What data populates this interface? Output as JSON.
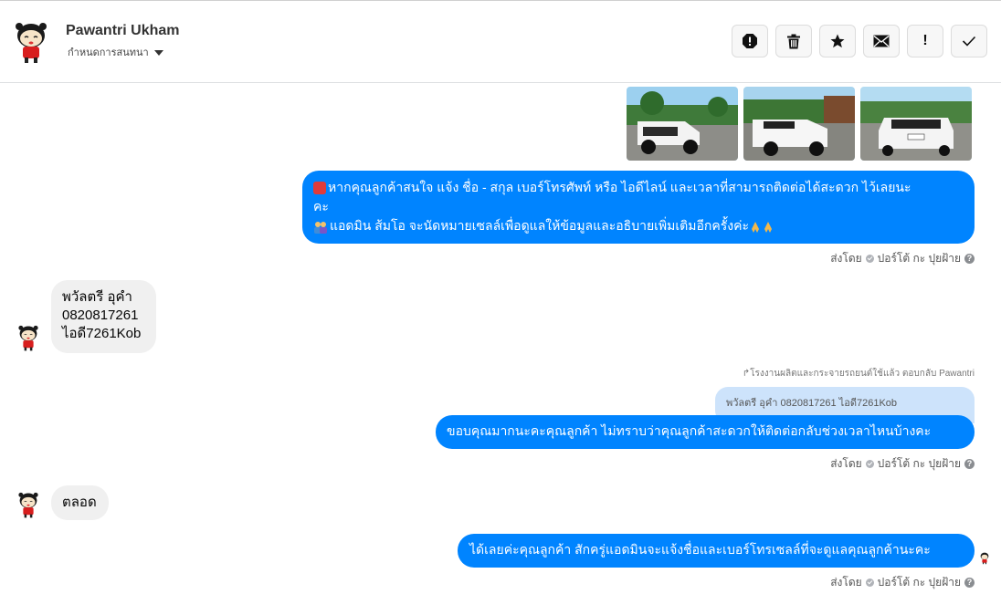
{
  "header": {
    "name": "Pawantri Ukham",
    "subtitle": "กำหนดการสนทนา",
    "actions": [
      {
        "label": "",
        "icon": "report-icon"
      },
      {
        "label": "",
        "icon": "trash-icon"
      },
      {
        "label": "",
        "icon": "star-icon"
      },
      {
        "label": "",
        "icon": "envelope-icon"
      },
      {
        "label": "!",
        "icon": "exclamation-icon"
      },
      {
        "label": "",
        "icon": "check-icon"
      }
    ]
  },
  "messages": {
    "m1": {
      "line1": "หากคุณลูกค้าสนใจ แจ้ง ชื่อ - สกุล เบอร์โทรศัพท์ หรือ ไอดีไลน์ และเวลาที่สามารถติดต่อได้สะดวก ไว้เลยนะ",
      "line2": "คะ",
      "line3": "แอดมิน ส้มโอ จะนัดหมายเซลล์เพื่อดูแลให้ข้อมูลและอธิบายเพิ่มเติมอีกครั้งค่ะ",
      "icon1": "telephone-icon",
      "icon2": "people-icon",
      "icon3": "pray-icon"
    },
    "sent_by": {
      "prefix": "ส่งโดย",
      "name": "ปอร์โต้ กะ ปุยฝ้าย",
      "help": "?"
    },
    "m2": {
      "line1": "พวัลตรี อุคำ",
      "line2": "0820817261",
      "line3": "ไอดี7261Kob"
    },
    "reply_note": "โรงงานผลิตและกระจายรถยนต์ใช้แล้ว ตอบกลับ Pawantri",
    "quoted": "พวัลตรี อุคำ 0820817261 ไอดี7261Kob",
    "m3": "ขอบคุณมากนะคะคุณลูกค้า ไม่ทราบว่าคุณลูกค้าสะดวกให้ติดต่อกลับช่วงเวลาไหนบ้างคะ",
    "m4": "ตลอด",
    "m5": "ได้เลยค่ะคุณลูกค้า สักครู่แอดมินจะแจ้งชื่อและเบอร์โทรเซลล์ที่จะดูแลคุณลูกค้านะคะ"
  },
  "colors": {
    "outgoing": "#0084ff",
    "incoming": "#f0f0f0",
    "quoted": "#cde3fb"
  }
}
